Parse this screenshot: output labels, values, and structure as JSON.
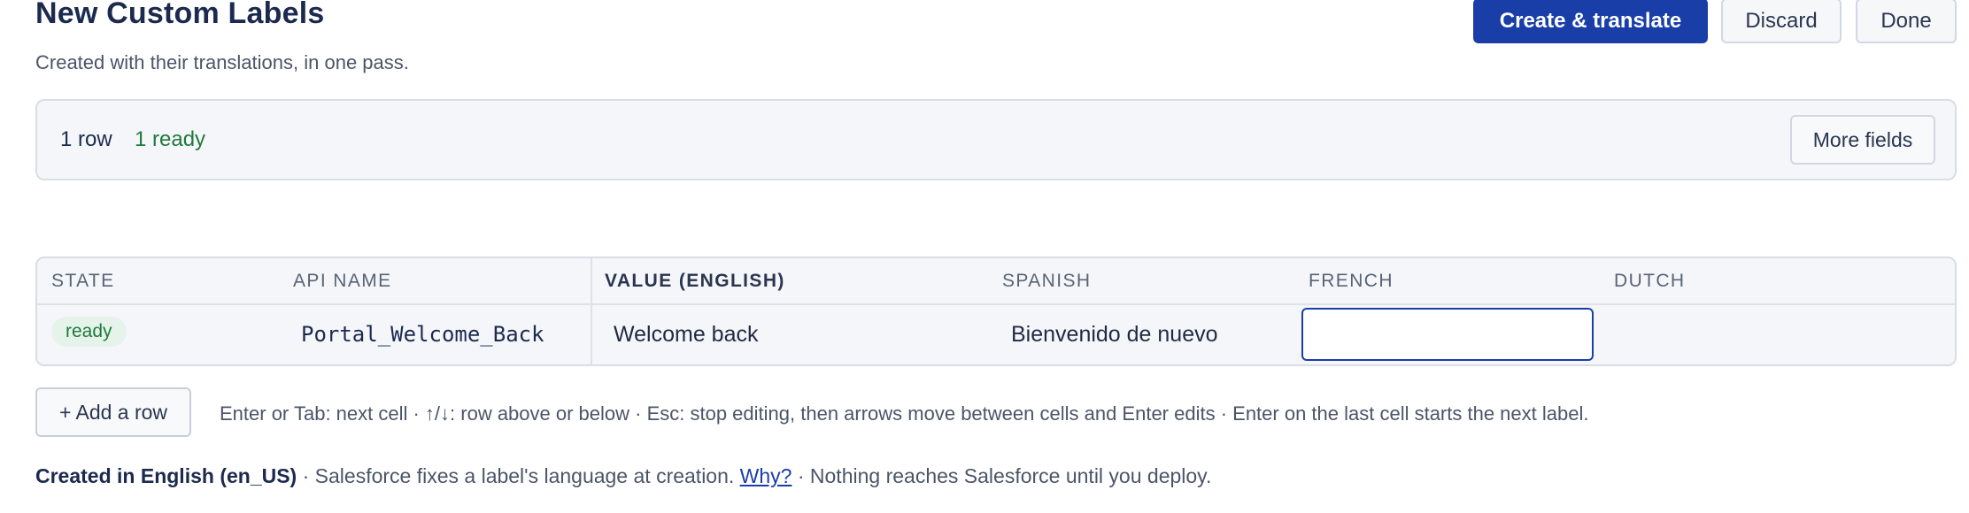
{
  "header": {
    "title": "New Custom Labels",
    "subtitle": "Created with their translations, in one pass.",
    "create_label": "Create & translate",
    "discard_label": "Discard",
    "done_label": "Done"
  },
  "summary": {
    "rows": "1 row",
    "ready": "1 ready",
    "more_fields_label": "More fields"
  },
  "table": {
    "columns": [
      "STATE",
      "API NAME",
      "VALUE (ENGLISH)",
      "SPANISH",
      "FRENCH",
      "DUTCH"
    ],
    "rows": [
      {
        "state": "ready",
        "api_name": "Portal_Welcome_Back",
        "value_english": "Welcome back",
        "spanish": "Bienvenido de nuevo",
        "french": "",
        "dutch": ""
      }
    ]
  },
  "actions": {
    "add_row_label": "+ Add a row",
    "hint": "Enter or Tab: next cell · ↑/↓: row above or below · Esc: stop editing, then arrows move between cells and Enter edits · Enter on the last cell starts the next label."
  },
  "footer": {
    "locale": "Created in English (en_US)",
    "text1": " · Salesforce fixes a label's language at creation. ",
    "why_link": "Why?",
    "text2": " · Nothing reaches Salesforce until you deploy."
  },
  "colors": {
    "primary": "#1a3ea8",
    "ready_green": "#1f7a3d",
    "ready_badge_bg": "#e6f3ea"
  }
}
